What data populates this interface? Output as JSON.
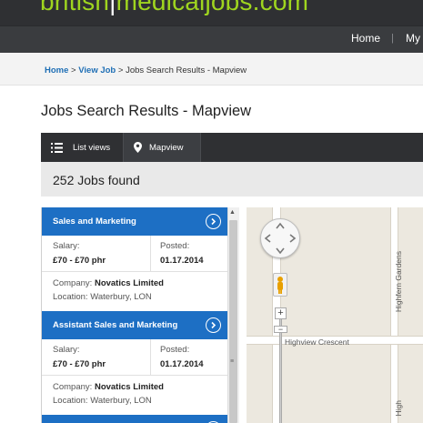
{
  "header": {
    "logo_part1": "british",
    "logo_part2": "medical",
    "logo_part3": "jobs.com",
    "nav": [
      {
        "label": "Home"
      },
      {
        "label": "My"
      }
    ]
  },
  "breadcrumb": {
    "home": "Home",
    "sep1": " > ",
    "view_job": "View Job",
    "sep2": " > ",
    "current": "Jobs Search Results - Mapview"
  },
  "page_title": "Jobs Search Results - Mapview",
  "view_toggle": {
    "list_label": "List views",
    "map_label": "Mapview"
  },
  "results_text": "252 Jobs found",
  "jobs": [
    {
      "title": "Sales and Marketing",
      "salary_label": "Salary:",
      "salary": "£70 - £70 phr",
      "posted_label": "Posted:",
      "posted": "01.17.2014",
      "company_label": "Company:",
      "company": "Novatics Limited",
      "location_label": "Location:",
      "location": "Waterbury, LON"
    },
    {
      "title": "Assistant Sales and Marketing",
      "salary_label": "Salary:",
      "salary": "£70 - £70 phr",
      "posted_label": "Posted:",
      "posted": "01.17.2014",
      "company_label": "Company:",
      "company": "Novatics Limited",
      "location_label": "Location:",
      "location": "Waterbury, LON"
    }
  ],
  "map": {
    "street_horizontal": "Highview Crescent",
    "street_vertical": "Highfern Gardens",
    "street_vertical_2": "High",
    "zoom_in": "+",
    "zoom_out": "−"
  },
  "colors": {
    "accent": "#1d6fc4",
    "header_bg": "#2f3033",
    "logo_green": "#9fd51f"
  }
}
